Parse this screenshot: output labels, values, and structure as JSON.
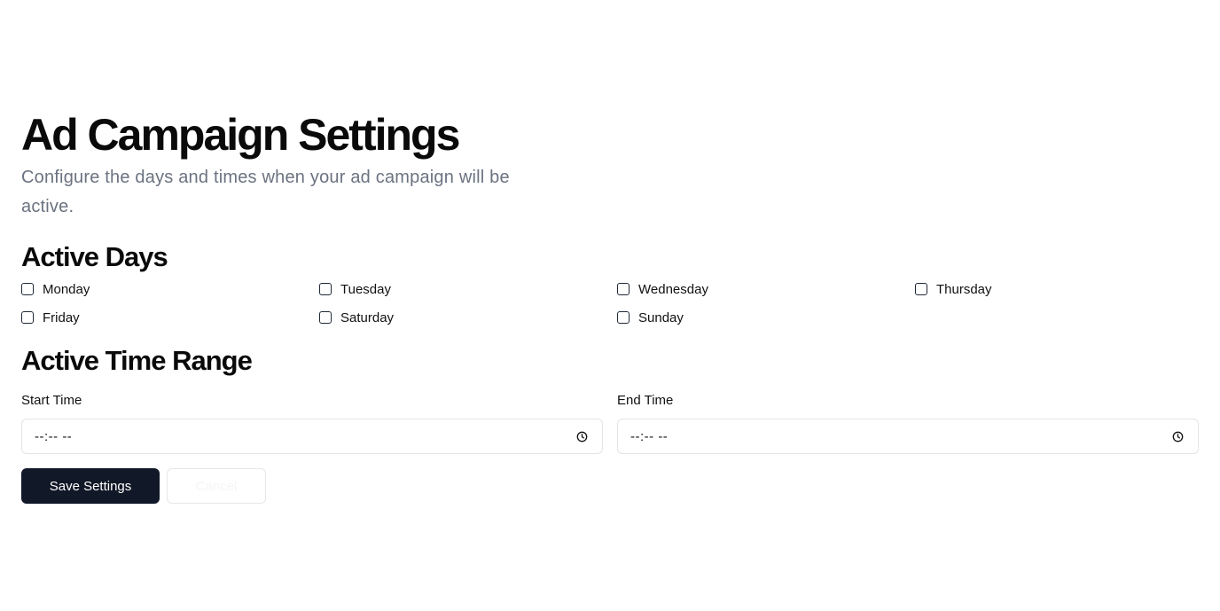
{
  "page": {
    "title": "Ad Campaign Settings",
    "subtitle": "Configure the days and times when your ad campaign will be active."
  },
  "days_section": {
    "heading": "Active Days",
    "days": [
      {
        "label": "Monday",
        "checked": false
      },
      {
        "label": "Tuesday",
        "checked": false
      },
      {
        "label": "Wednesday",
        "checked": false
      },
      {
        "label": "Thursday",
        "checked": false
      },
      {
        "label": "Friday",
        "checked": false
      },
      {
        "label": "Saturday",
        "checked": false
      },
      {
        "label": "Sunday",
        "checked": false
      }
    ]
  },
  "time_section": {
    "heading": "Active Time Range",
    "start": {
      "label": "Start Time",
      "value": "--:-- --",
      "icon": "clock-icon"
    },
    "end": {
      "label": "End Time",
      "value": "--:-- --",
      "icon": "clock-icon"
    }
  },
  "actions": {
    "save_label": "Save Settings",
    "cancel_label": "Cancel"
  },
  "colors": {
    "primary_button": "#111827",
    "subtitle_text": "#6b7280",
    "input_border": "#e4e4e7"
  }
}
